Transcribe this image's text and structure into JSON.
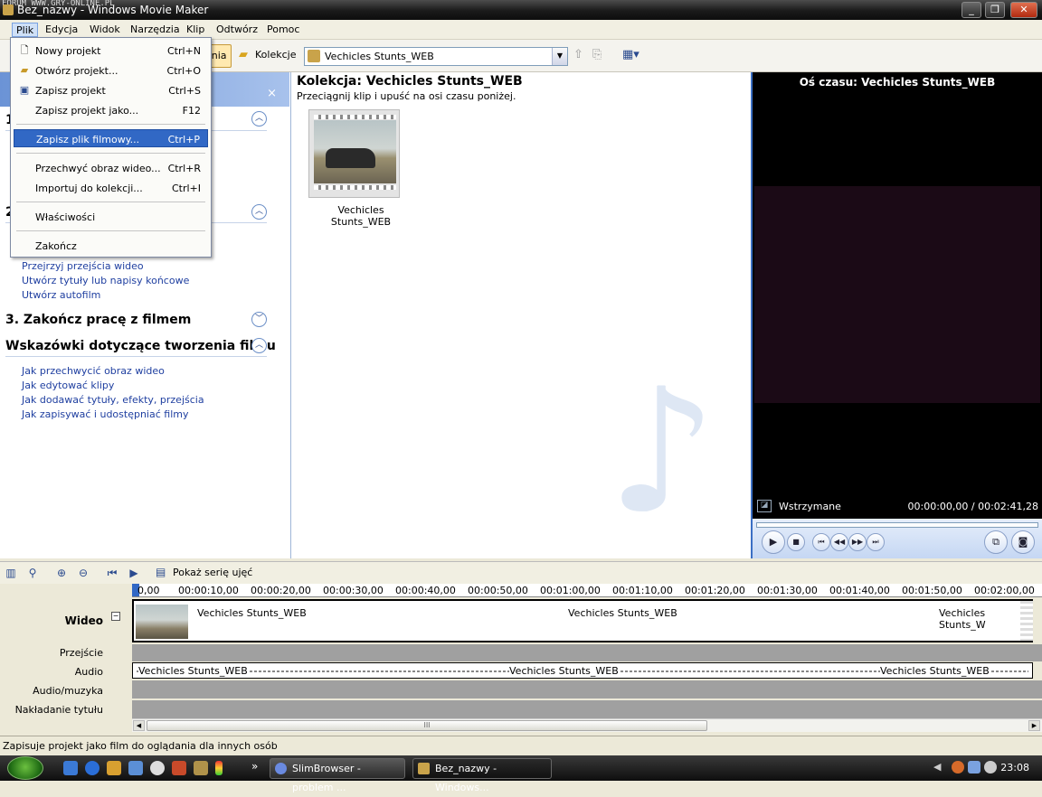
{
  "watermark": "FORUM WWW.GRY-ONLINE.PL",
  "window": {
    "title": "Bez_nazwy - Windows Movie Maker"
  },
  "menubar": [
    "Plik",
    "Edycja",
    "Widok",
    "Narzędzia",
    "Klip",
    "Odtwórz",
    "Pomoc"
  ],
  "toolbar": {
    "tasks_label": "ania",
    "collections_label": "Kolekcje",
    "collection_select": "Vechicles Stunts_WEB"
  },
  "file_menu": [
    {
      "label": "Nowy projekt",
      "shortcut": "Ctrl+N"
    },
    {
      "label": "Otwórz projekt...",
      "shortcut": "Ctrl+O"
    },
    {
      "label": "Zapisz projekt",
      "shortcut": "Ctrl+S"
    },
    {
      "label": "Zapisz projekt jako...",
      "shortcut": "F12"
    },
    {
      "label": "Zapisz plik filmowy...",
      "shortcut": "Ctrl+P"
    },
    {
      "label": "Przechwyć obraz wideo...",
      "shortcut": "Ctrl+R"
    },
    {
      "label": "Importuj do kolekcji...",
      "shortcut": "Ctrl+I"
    },
    {
      "label": "Właściwości",
      "shortcut": ""
    },
    {
      "label": "Zakończ",
      "shortcut": ""
    }
  ],
  "taskpane": {
    "close": "×",
    "sec1_num": "1",
    "sec2_num": "2",
    "sec2_links": [
      "Przejrzyj przejścia wideo",
      "Utwórz tytuły lub napisy końcowe",
      "Utwórz autofilm"
    ],
    "sec3_title": "3. Zakończ pracę z filmem",
    "tips_title": "Wskazówki dotyczące tworzenia filmu",
    "tips_links": [
      "Jak przechwycić obraz wideo",
      "Jak edytować klipy",
      "Jak dodawać tytuły, efekty, przejścia",
      "Jak zapisywać i udostępniać filmy"
    ]
  },
  "collection": {
    "title": "Kolekcja: Vechicles Stunts_WEB",
    "subtitle": "Przeciągnij klip i upuść na osi czasu poniżej.",
    "clip_name": "Vechicles Stunts_WEB"
  },
  "preview": {
    "title": "Oś czasu: Vechicles Stunts_WEB",
    "status": "Wstrzymane",
    "time": "00:00:00,00 / 00:02:41,28"
  },
  "timeline": {
    "show_storyboard": "Pokaż serię ujęć",
    "ruler": [
      "0,00",
      "00:00:10,00",
      "00:00:20,00",
      "00:00:30,00",
      "00:00:40,00",
      "00:00:50,00",
      "00:01:00,00",
      "00:01:10,00",
      "00:01:20,00",
      "00:01:30,00",
      "00:01:40,00",
      "00:01:50,00",
      "00:02:00,00"
    ],
    "tracks": {
      "video": "Wideo",
      "transition": "Przejście",
      "audio": "Audio",
      "audio_music": "Audio/muzyka",
      "title_overlay": "Nakładanie tytułu"
    },
    "video_clip_labels": [
      "Vechicles Stunts_WEB",
      "Vechicles Stunts_WEB",
      "Vechicles Stunts_W"
    ],
    "audio_clip_labels": [
      "Vechicles Stunts_WEB",
      "Vechicles Stunts_WEB",
      "Vechicles Stunts_WEB"
    ],
    "scroll_grip": "III"
  },
  "statusbar": "Zapisuje projekt jako film do oglądania dla innych osób",
  "taskbar": {
    "tasks": [
      "SlimBrowser - problem ...",
      "Bez_nazwy - Windows..."
    ],
    "clock": "23:08",
    "more": "»"
  }
}
